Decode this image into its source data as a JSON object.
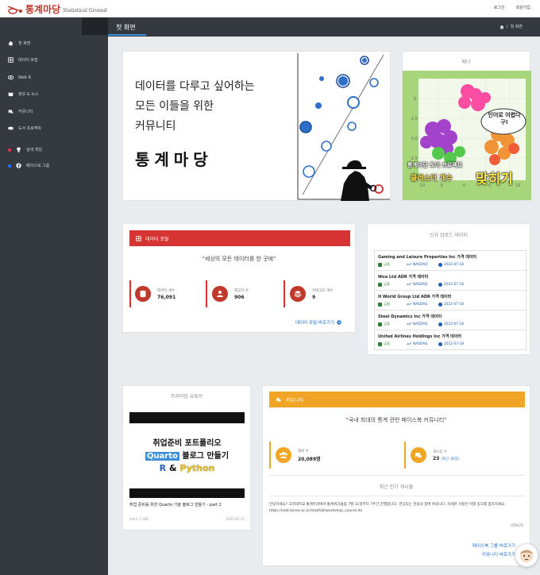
{
  "header": {
    "logo_ko": "통계마당",
    "logo_en": "Statistical Ground",
    "login": "로그인",
    "signup": "회원가입"
  },
  "sidebar": {
    "items": [
      {
        "label": "첫 화면",
        "icon": "home-icon"
      },
      {
        "label": "데이터 포털",
        "icon": "table-icon"
      },
      {
        "label": "Web R",
        "icon": "eye-icon"
      },
      {
        "label": "정보 & 뉴스",
        "icon": "book-icon"
      },
      {
        "label": "커뮤니티",
        "icon": "chat-icon"
      },
      {
        "label": "도서 프로젝트",
        "icon": "pill-icon"
      }
    ],
    "links": [
      {
        "label": "검색 게임",
        "color": "#e0393e"
      },
      {
        "label": "페이스북 그룹",
        "color": "#1877f2"
      }
    ]
  },
  "main": {
    "tab": "첫 화면",
    "breadcrumb": "첫 화면"
  },
  "hero": {
    "line1": "데이터를 다루고 싶어하는",
    "line2": "모든 이들을 위한",
    "line3": "커뮤니티",
    "big": "통계마당"
  },
  "banner": {
    "title": "배너",
    "bubble": "인어로 어렵다구!",
    "caption1": "통계마당 토이 프로젝트",
    "caption2": "클러스터 개수",
    "caption3": "맞히기"
  },
  "portal": {
    "header": "데이터 포털",
    "quote": "\"세상의 모든 데이터를 한 곳에\"",
    "stats": [
      {
        "label": "데이터 개수",
        "value": "76,091"
      },
      {
        "label": "제공자 수",
        "value": "906"
      },
      {
        "label": "카테고리 개수",
        "value": "9"
      }
    ],
    "link": "데이터 포털 바로가기"
  },
  "newdata": {
    "title": "신규 업로드 데이터",
    "rows": [
      {
        "title": "Gaming and Leisure Properties Inc 가격 데이터",
        "category": "금융",
        "exchange": "NASDAQ",
        "date": "2022-07-18"
      },
      {
        "title": "Nice Ltd ADR 가격 데이터",
        "category": "금융",
        "exchange": "NASDAQ",
        "date": "2022-07-18"
      },
      {
        "title": "H World Group Ltd ADR 가격 데이터",
        "category": "금융",
        "exchange": "NASDAQ",
        "date": "2022-07-18"
      },
      {
        "title": "Steel Dynamics Inc 가격 데이터",
        "category": "금융",
        "exchange": "NASDAQ",
        "date": "2022-07-18"
      },
      {
        "title": "United Airlines Holdings Inc 가격 데이터",
        "category": "금융",
        "exchange": "NASDAQ",
        "date": "2022-07-18"
      }
    ]
  },
  "youtube": {
    "title": "프리미엄 유튜브",
    "thumb_line1": "취업준비 포트폴리오",
    "thumb_quarto": "Quarto",
    "thumb_line2": "블로그 만들기",
    "thumb_r": "R",
    "thumb_amp": "&",
    "thumb_python": "Python",
    "video_title": "취업 준비를 위한 Quarto 기술 블로그 만들기 - part 2",
    "views": "조회수 7,280",
    "date": "2022-07-11"
  },
  "community": {
    "header": "커뮤니티",
    "quote": "\"국내 최대의 통계 관련 페이스북 커뮤니티\"",
    "stats": [
      {
        "label": "멤버 수",
        "value": "20,089명"
      },
      {
        "label": "게시글 수",
        "value": "23",
        "sub": "(최근 30일)"
      }
    ],
    "popular_title": "최근 인기 게시물",
    "notice": "안녕하세요? 고려대학교 통계학과에서 통계워크숍을 7월 11일부터 7주간 진행합니다. 관심있는 분들의 참여 바랍니다. 자세한 사항은 아래 링크를 참조하세요. https://stat.korea.ac.kr/stat/lab/workshop_course.do",
    "more": "(더보기)",
    "link1": "페이스북 그룹 바로가기",
    "link2": "커뮤니티 바로가기"
  }
}
